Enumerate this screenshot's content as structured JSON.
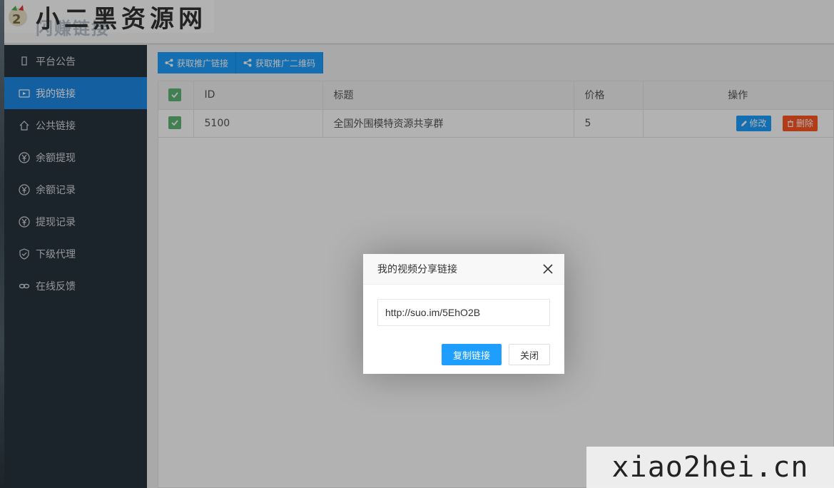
{
  "header": {
    "logo_text": "小二黑资源网",
    "brand_sub": "闪赚链接"
  },
  "sidebar": {
    "items": [
      {
        "label": "平台公告",
        "icon": "notice-icon",
        "active": false
      },
      {
        "label": "我的链接",
        "icon": "video-icon",
        "active": true
      },
      {
        "label": "公共链接",
        "icon": "home-icon",
        "active": false
      },
      {
        "label": "余额提现",
        "icon": "yen-icon",
        "active": false
      },
      {
        "label": "余额记录",
        "icon": "yen-icon",
        "active": false
      },
      {
        "label": "提现记录",
        "icon": "yen-icon",
        "active": false
      },
      {
        "label": "下级代理",
        "icon": "shield-icon",
        "active": false
      },
      {
        "label": "在线反馈",
        "icon": "link-icon",
        "active": false
      }
    ]
  },
  "toolbar": {
    "get_link_label": "获取推广链接",
    "get_qr_label": "获取推广二维码"
  },
  "table": {
    "headers": {
      "id": "ID",
      "title": "标题",
      "price": "价格",
      "ops": "操作"
    },
    "rows": [
      {
        "id": "5100",
        "title": "全国外围模特资源共享群",
        "price": "5",
        "edit": "修改",
        "delete": "删除"
      }
    ]
  },
  "modal": {
    "title": "我的视频分享链接",
    "url_value": "http://suo.im/5EhO2B",
    "copy_label": "复制链接",
    "close_label": "关闭"
  },
  "watermark": {
    "text": "xiao2hei.cn"
  },
  "colors": {
    "accent": "#1e9fff",
    "danger": "#ff5722",
    "check": "#5fb878",
    "sidebar_bg": "#28333e"
  }
}
